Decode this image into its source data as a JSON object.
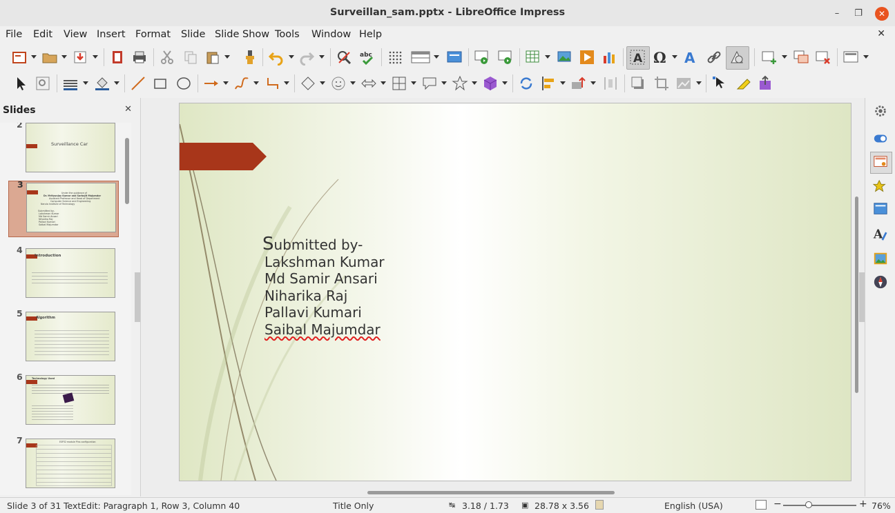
{
  "window": {
    "title": "Surveillan_sam.pptx - LibreOffice Impress"
  },
  "menu": [
    "File",
    "Edit",
    "View",
    "Insert",
    "Format",
    "Slide",
    "Slide Show",
    "Tools",
    "Window",
    "Help"
  ],
  "slides_panel": {
    "title": "Slides",
    "items": [
      {
        "number": "2",
        "text": "Surveillance Car"
      },
      {
        "number": "3",
        "lines": [
          "Under the guidance of",
          "Dr. Mrityunjay Kumar and Sarbajit Majumdar",
          "Assistant Professor and Head of Department",
          "Computer Science and Engineering",
          "Narula Institute of Technology"
        ],
        "sub": [
          "Submitted by-",
          "Lakshman Kumar",
          "Md Samir Ansari",
          "Niharika Raj",
          "Pallavi Kumari",
          "Saibal Majumdar"
        ]
      },
      {
        "number": "4",
        "text": "Introduction"
      },
      {
        "number": "5",
        "text": "Algorithm"
      },
      {
        "number": "6",
        "text": "Technology Used"
      },
      {
        "number": "7",
        "text": "ESP32 module Pins configuration"
      }
    ]
  },
  "slide": {
    "content": [
      "Submitted by-",
      "Lakshman Kumar",
      "Md Samir Ansari",
      "Niharika Raj",
      "Pallavi Kumari",
      "Saibal Majumdar"
    ]
  },
  "status": {
    "slide_info": "Slide 3 of 31",
    "edit_info": "TextEdit: Paragraph 1, Row 3, Column 40",
    "layout": "Title Only",
    "position": "3.18 / 1.73",
    "size": "28.78 x 3.56",
    "language": "English (USA)",
    "zoom": "76%"
  },
  "colors": {
    "accent": "#a8361a",
    "close": "#e95420"
  }
}
